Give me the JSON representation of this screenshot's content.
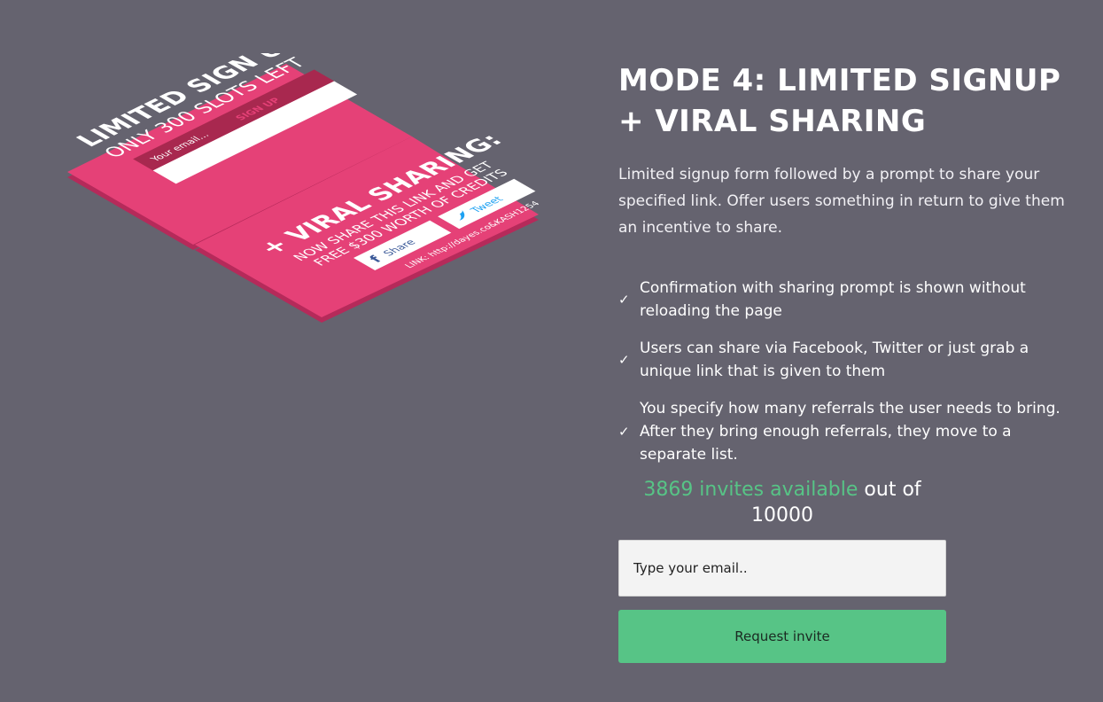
{
  "illustration": {
    "title_line1": "LIMITED SIGN UP",
    "title_line2": "ONLY 300 SLOTS LEFT",
    "email_placeholder": "Your email...",
    "signup_label": "SIGN UP",
    "viral_title": "+ VIRAL SHARING:",
    "viral_line1": "NOW SHARE THIS LINK AND GET",
    "viral_line2": "FREE $300 WORTH OF CREDITS",
    "share_label": "Share",
    "tweet_label": "Tweet",
    "link_text": "LINK: http://dayes.co&KASH1254",
    "colors": {
      "card": "#e54177",
      "card_edge": "#b52a5a",
      "dark_row": "#a8284f"
    }
  },
  "heading": "MODE 4: LIMITED SIGNUP + VIRAL SHARING",
  "description": "Limited signup form followed by a prompt to share your specified link. Offer users something in return to give them an incentive to share.",
  "features": [
    {
      "icon": "check-icon",
      "text": "Confirmation with sharing prompt is shown without reloading the page"
    },
    {
      "icon": "check-icon",
      "text": "Users can share via Facebook, Twitter or just grab a unique link that is given to them"
    },
    {
      "icon": "check-icon",
      "text": "You specify how many referrals the user needs to bring. After they bring enough referrals, they move to a separate list."
    }
  ],
  "counter": {
    "available_text": "3869 invites available",
    "out_of_text": "out of",
    "total": "10000"
  },
  "form": {
    "email_placeholder": "Type your email..",
    "button_label": "Request invite"
  },
  "colors": {
    "background": "#65636f",
    "accent": "#57c486"
  }
}
